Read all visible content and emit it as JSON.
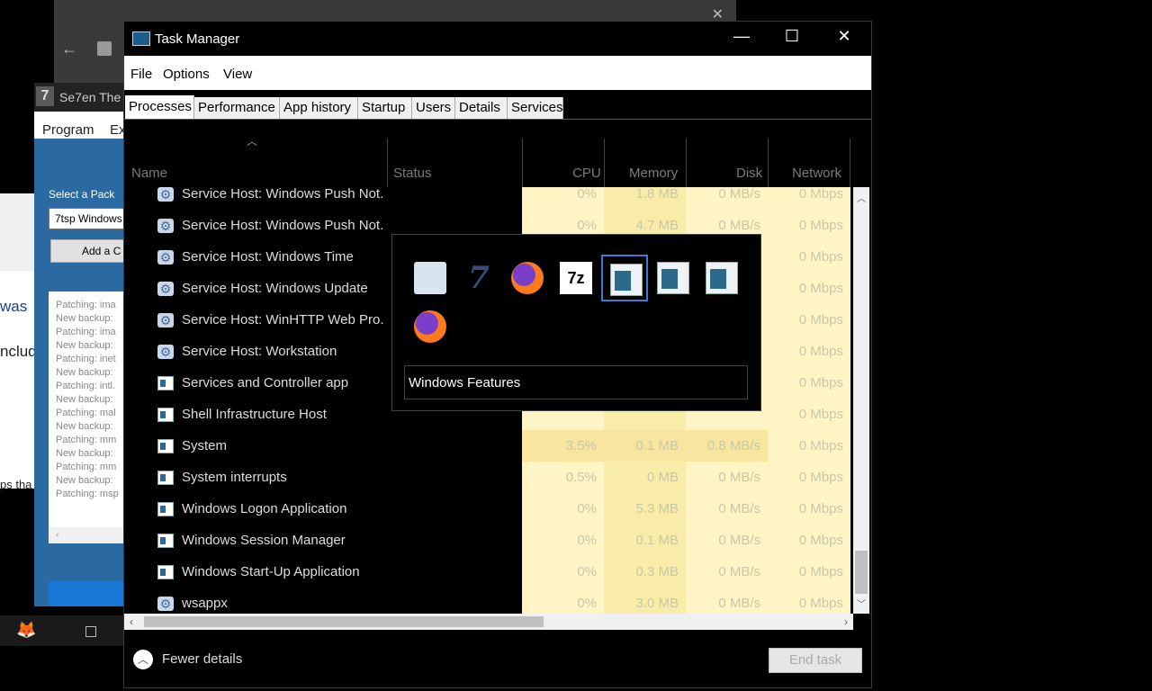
{
  "background": {
    "seven": {
      "title": "Se7en The",
      "logo": "7",
      "menu": [
        "Program",
        "Ex"
      ],
      "select_label": "Select a Pack",
      "combo_value": "7tsp Windows",
      "add_button": "Add a C",
      "log_lines": [
        "Patching: ima",
        "New backup:",
        "Patching: ima",
        "New backup:",
        "Patching: inet",
        "New backup:",
        "Patching: intl.",
        "New backup:",
        "Patching: mal",
        "New backup:",
        "Patching: mm",
        "New backup:",
        "Patching: mm",
        "New backup:",
        "Patching: msp"
      ]
    },
    "left_text": [
      "was",
      "nclud",
      "ps tha"
    ]
  },
  "taskmanager": {
    "title": "Task Manager",
    "menu": [
      "File",
      "Options",
      "View"
    ],
    "tabs": [
      "Processes",
      "Performance",
      "App history",
      "Startup",
      "Users",
      "Details",
      "Services"
    ],
    "active_tab": "Processes",
    "columns": {
      "name": "Name",
      "status": "Status",
      "cpu": "CPU",
      "memory": "Memory",
      "disk": "Disk",
      "network": "Network"
    },
    "rows": [
      {
        "icon": "gear",
        "name": "Service Host: Windows Push Not...",
        "cpu": "0%",
        "mem": "1.8 MB",
        "disk": "0 MB/s",
        "net": "0 Mbps"
      },
      {
        "icon": "gear",
        "name": "Service Host: Windows Push Not...",
        "cpu": "0%",
        "mem": "4.7 MB",
        "disk": "0 MB/s",
        "net": "0 Mbps"
      },
      {
        "icon": "gear",
        "name": "Service Host: Windows Time",
        "cpu": "",
        "mem": "",
        "disk": "",
        "net": "0 Mbps"
      },
      {
        "icon": "gear",
        "name": "Service Host: Windows Update",
        "cpu": "",
        "mem": "",
        "disk": "",
        "net": "0 Mbps"
      },
      {
        "icon": "gear",
        "name": "Service Host: WinHTTP Web Pro...",
        "cpu": "",
        "mem": "",
        "disk": "",
        "net": "0 Mbps"
      },
      {
        "icon": "gear",
        "name": "Service Host: Workstation",
        "cpu": "",
        "mem": "",
        "disk": "",
        "net": "0 Mbps"
      },
      {
        "icon": "win",
        "name": "Services and Controller app",
        "cpu": "",
        "mem": "",
        "disk": "",
        "net": "0 Mbps"
      },
      {
        "icon": "win",
        "name": "Shell Infrastructure Host",
        "cpu": "",
        "mem": "",
        "disk": "",
        "net": "0 Mbps"
      },
      {
        "icon": "win",
        "name": "System",
        "cpu": "3.5%",
        "mem": "0.1 MB",
        "disk": "0.8 MB/s",
        "net": "0 Mbps"
      },
      {
        "icon": "win",
        "name": "System interrupts",
        "cpu": "0.5%",
        "mem": "0 MB",
        "disk": "0 MB/s",
        "net": "0 Mbps"
      },
      {
        "icon": "win",
        "name": "Windows Logon Application",
        "cpu": "0%",
        "mem": "5.3 MB",
        "disk": "0 MB/s",
        "net": "0 Mbps"
      },
      {
        "icon": "win",
        "name": "Windows Session Manager",
        "cpu": "0%",
        "mem": "0.1 MB",
        "disk": "0 MB/s",
        "net": "0 Mbps"
      },
      {
        "icon": "win",
        "name": "Windows Start-Up Application",
        "cpu": "0%",
        "mem": "0.3 MB",
        "disk": "0 MB/s",
        "net": "0 Mbps"
      },
      {
        "icon": "gear",
        "name": "wsappx",
        "cpu": "0%",
        "mem": "3.0 MB",
        "disk": "0 MB/s",
        "net": "0 Mbps"
      }
    ],
    "fewer_details": "Fewer details",
    "end_task": "End task"
  },
  "alttab": {
    "tiles": [
      "task-manager-icon",
      "se7en-icon",
      "firefox-icon",
      "7zip-icon",
      "window-icon",
      "window-icon",
      "window-icon",
      "firefox-icon"
    ],
    "selected_index": 4,
    "label": "Windows Features"
  }
}
